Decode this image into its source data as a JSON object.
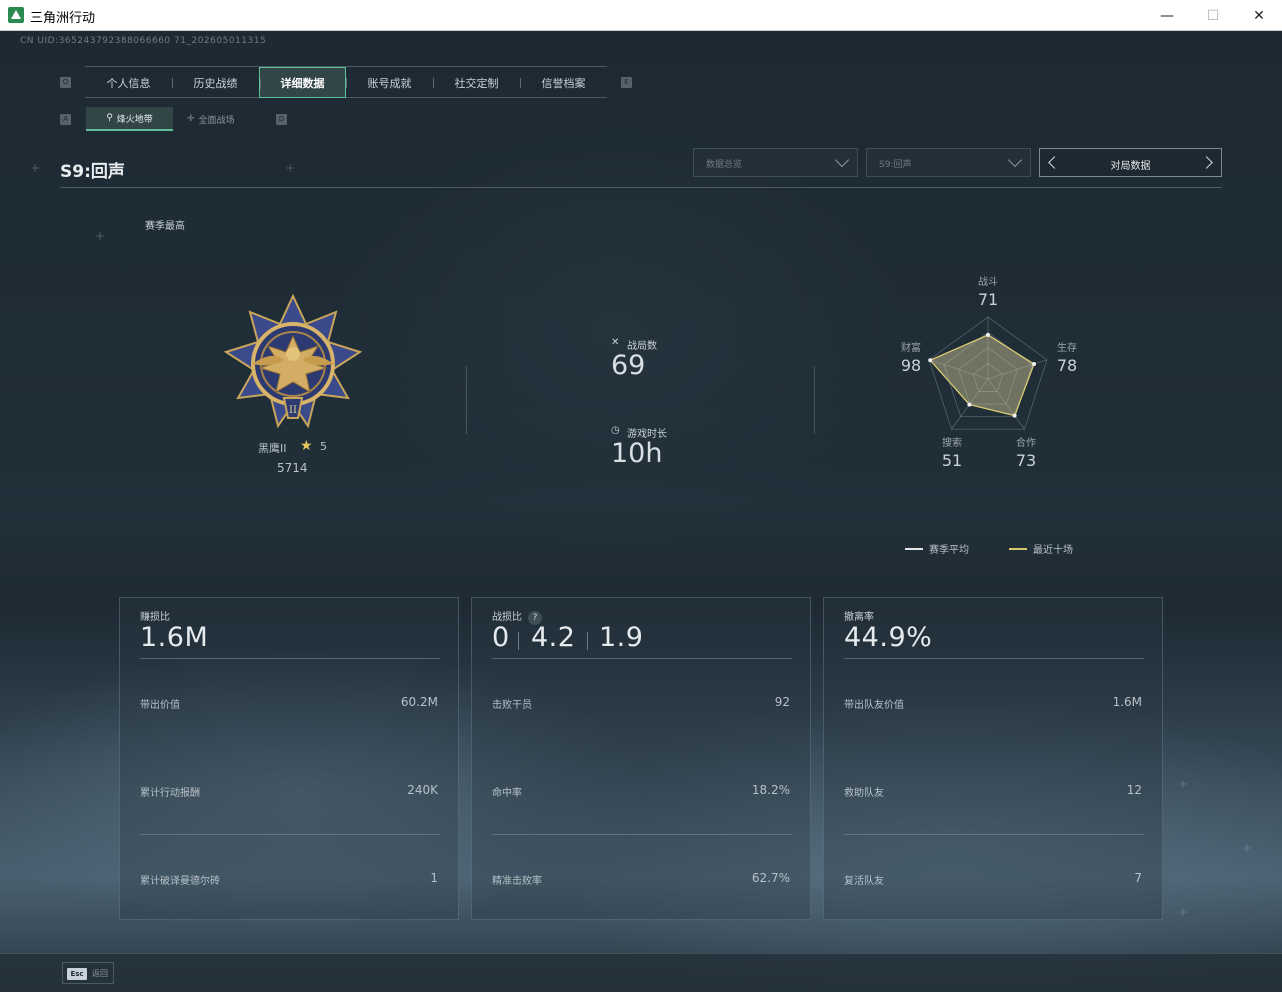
{
  "window": {
    "title": "三角洲行动"
  },
  "uid": "CN UID:365243792388066660 71_202605011315",
  "tabs": [
    {
      "label": "个人信息"
    },
    {
      "label": "历史战绩"
    },
    {
      "label": "详细数据"
    },
    {
      "label": "账号成就"
    },
    {
      "label": "社交定制"
    },
    {
      "label": "信誉档案"
    }
  ],
  "tab_keys": {
    "left": "Q",
    "right": "E"
  },
  "subtabs": [
    {
      "label": "烽火地带",
      "icon": "radar-icon"
    },
    {
      "label": "全面战场",
      "icon": "crosshair-icon"
    }
  ],
  "subtab_keys": {
    "left": "A",
    "right": "D"
  },
  "season": {
    "title": "S9:回声"
  },
  "filters": {
    "data_scope": "数据总览",
    "season": "S9:回声",
    "match_nav": "对局数据"
  },
  "season_high_label": "赛季最高",
  "rank": {
    "name": "黑鹰II",
    "stars": "5",
    "score": "5714"
  },
  "summary": {
    "matches_label": "战局数",
    "matches_value": "69",
    "playtime_label": "游戏时长",
    "playtime_value": "10h"
  },
  "radar": {
    "axes": [
      {
        "label": "战斗",
        "value": "71"
      },
      {
        "label": "生存",
        "value": "78"
      },
      {
        "label": "合作",
        "value": "73"
      },
      {
        "label": "搜索",
        "value": "51"
      },
      {
        "label": "财富",
        "value": "98"
      }
    ],
    "series": [
      {
        "name": "赛季平均",
        "color": "#e6e6e6",
        "values": [
          71,
          78,
          73,
          51,
          98
        ]
      },
      {
        "name": "最近十场",
        "color": "#d8c86a",
        "values": [
          71,
          78,
          73,
          51,
          98
        ]
      }
    ],
    "max": 100
  },
  "panels": [
    {
      "label": "赚损比",
      "value": "1.6M",
      "rows": [
        {
          "label": "带出价值",
          "value": "60.2M"
        },
        {
          "label": "累计行动报酬",
          "value": "240K"
        },
        {
          "label": "累计破译曼德尔砖",
          "value": "1"
        }
      ]
    },
    {
      "label": "战损比",
      "help": "?",
      "values": [
        "0",
        "4.2",
        "1.9"
      ],
      "rows": [
        {
          "label": "击败干员",
          "value": "92"
        },
        {
          "label": "命中率",
          "value": "18.2%"
        },
        {
          "label": "精准击败率",
          "value": "62.7%"
        }
      ]
    },
    {
      "label": "撤离率",
      "value": "44.9%",
      "rows": [
        {
          "label": "带出队友价值",
          "value": "1.6M"
        },
        {
          "label": "救助队友",
          "value": "12"
        },
        {
          "label": "复活队友",
          "value": "7"
        }
      ]
    }
  ],
  "bottom": {
    "esc_key": "Esc",
    "esc_label": "返回"
  },
  "colors": {
    "accent": "#5ec19a",
    "gold": "#e6c65a"
  }
}
